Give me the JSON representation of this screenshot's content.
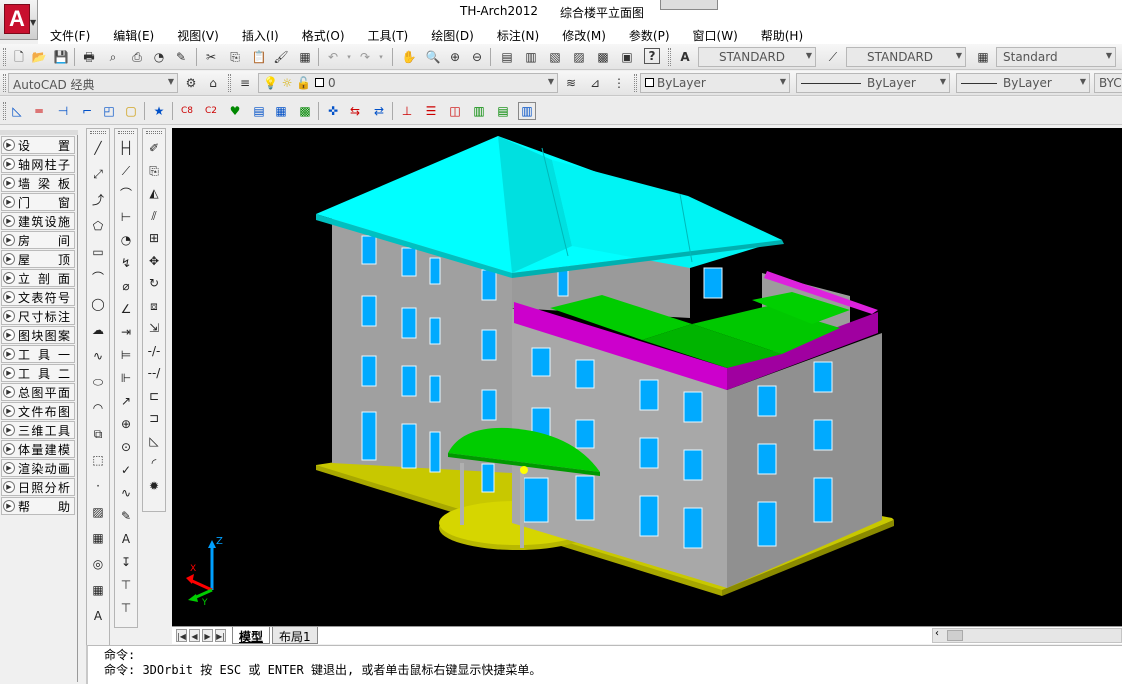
{
  "window": {
    "app_name": "TH-Arch2012",
    "document_title": "综合楼平立面图",
    "logo_letter": "A"
  },
  "menu": [
    "文件(F)",
    "编辑(E)",
    "视图(V)",
    "插入(I)",
    "格式(O)",
    "工具(T)",
    "绘图(D)",
    "标注(N)",
    "修改(M)",
    "参数(P)",
    "窗口(W)",
    "帮助(H)"
  ],
  "toolbar1": {
    "text_style": "STANDARD",
    "dim_style": "STANDARD",
    "table_style": "Standard"
  },
  "toolbar2": {
    "workspace": "AutoCAD 经典",
    "layer": "0",
    "color": "ByLayer",
    "linetype": "ByLayer",
    "lineweight": "ByLayer",
    "plot_style": "BYCO"
  },
  "tianzheng_menu": [
    "设 置",
    "轴网柱子",
    "墙 梁 板",
    "门 窗",
    "建筑设施",
    "房 间",
    "屋 顶",
    "立 剖 面",
    "文表符号",
    "尺寸标注",
    "图块图案",
    "工 具 一",
    "工 具 二",
    "总图平面",
    "文件布图",
    "三维工具",
    "体量建模",
    "渲染动画",
    "日照分析",
    "帮 助"
  ],
  "draw_tools": [
    "line-icon",
    "construction-line-icon",
    "polyline-icon",
    "polygon-icon",
    "rectangle-icon",
    "arc-icon",
    "circle-icon",
    "revision-cloud-icon",
    "spline-icon",
    "ellipse-icon",
    "ellipse-arc-icon",
    "insert-block-icon",
    "make-block-icon",
    "point-icon",
    "hatch-icon",
    "gradient-icon",
    "region-icon",
    "table-icon",
    "multiline-text-icon"
  ],
  "modify_tools": [
    "erase-icon",
    "copy-icon",
    "mirror-icon",
    "offset-icon",
    "array-icon",
    "move-icon",
    "rotate-icon",
    "scale-icon",
    "stretch-icon",
    "trim-icon",
    "extend-icon",
    "break-icon",
    "join-icon",
    "chamfer-icon",
    "fillet-icon",
    "explode-icon"
  ],
  "viewport": {
    "axis_z": "Z",
    "axis_x": "X",
    "axis_y": "Y",
    "colors": {
      "background": "#000000",
      "roof": "#00ffff",
      "wall": "#a8a8a8",
      "parapet": "#cc00cc",
      "terrace": "#00cc00",
      "base": "#c8c800",
      "window": "#00aaff"
    }
  },
  "layout_tabs": [
    "模型",
    "布局1"
  ],
  "active_tab": "模型",
  "command": {
    "line1": "命令:",
    "line2": "命令: 3DOrbit 按 ESC 或 ENTER 键退出, 或者单击鼠标右键显示快捷菜单。"
  }
}
